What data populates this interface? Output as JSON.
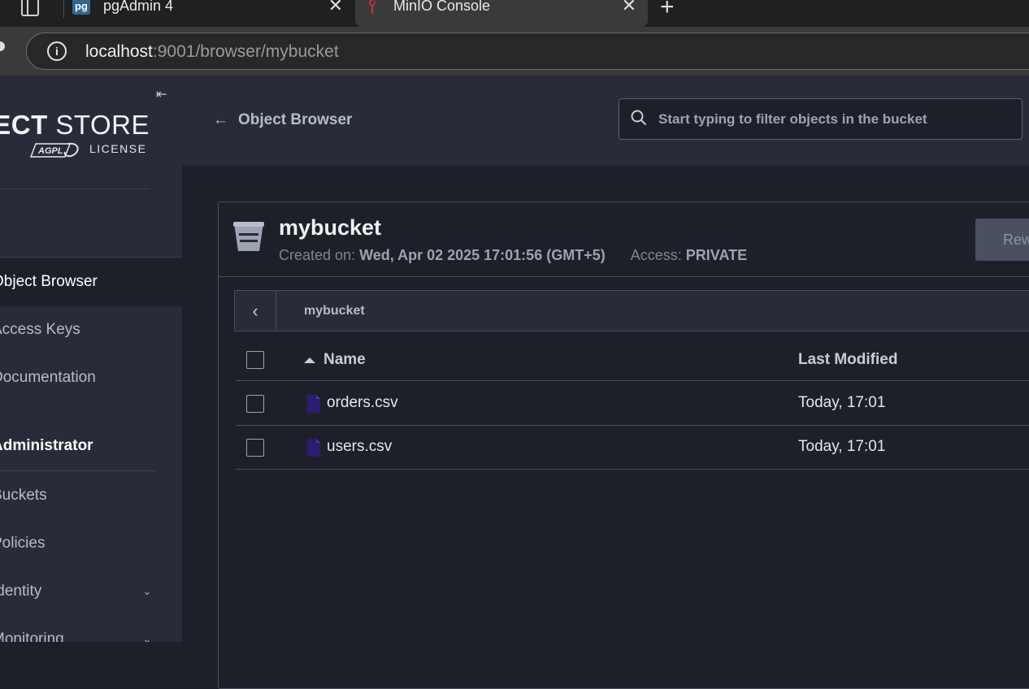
{
  "browser": {
    "tabs": [
      {
        "title": "pgAdmin 4",
        "icon": "pgadmin-icon",
        "active": false
      },
      {
        "title": "MinIO Console",
        "icon": "minio-icon",
        "active": true
      }
    ],
    "pg_icon_text": "pg",
    "close_glyph": "✕",
    "new_tab_glyph": "+",
    "url_host": "localhost",
    "url_rest": ":9001/browser/mybucket",
    "info_glyph": "i"
  },
  "sidebar": {
    "logo_bold": "ECT",
    "logo_light": " STORE",
    "license": "LICENSE",
    "badge_text": "AGPL",
    "collapse_glyph": "⇤",
    "items": [
      {
        "label": "Object Browser",
        "active": true
      },
      {
        "label": "Access Keys",
        "active": false
      },
      {
        "label": "Documentation",
        "active": false
      }
    ],
    "section_title": "Administrator",
    "admin_items": [
      {
        "label": "Buckets",
        "expandable": false
      },
      {
        "label": "Policies",
        "expandable": false
      },
      {
        "label": "Identity",
        "expandable": true
      },
      {
        "label": "Monitoring",
        "expandable": true
      }
    ],
    "chevron_glyph": "⌄"
  },
  "header": {
    "back_arrow": "←",
    "back_label": "Object Browser",
    "search_placeholder": "Start typing to filter objects in the bucket"
  },
  "bucket": {
    "name": "mybucket",
    "created_label": "Created on:",
    "created_value": "Wed, Apr 02 2025 17:01:56 (GMT+5)",
    "access_label": "Access:",
    "access_value": "PRIVATE",
    "rewind_label": "Rewind"
  },
  "breadcrumb": {
    "back_glyph": "‹",
    "path": "mybucket"
  },
  "table": {
    "columns": [
      "Name",
      "Last Modified"
    ],
    "rows": [
      {
        "name": "orders.csv",
        "modified": "Today, 17:01"
      },
      {
        "name": "users.csv",
        "modified": "Today, 17:01"
      }
    ]
  },
  "colors": {
    "accent_file_icon": "#2b1d6e",
    "sidebar_bg": "#282b38",
    "content_bg": "#1e2029"
  }
}
